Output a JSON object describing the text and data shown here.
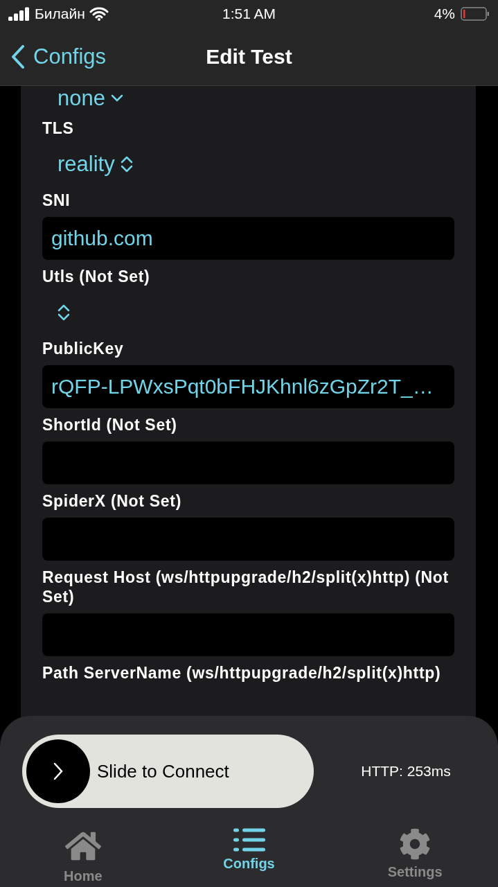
{
  "status_bar": {
    "carrier": "Билайн",
    "time": "1:51 AM",
    "battery": "4%"
  },
  "nav": {
    "back": "Configs",
    "title": "Edit Test"
  },
  "form": [
    {
      "kind": "picker",
      "value": "none"
    },
    {
      "kind": "label",
      "text": "TLS"
    },
    {
      "kind": "picker",
      "value": "reality"
    },
    {
      "kind": "label",
      "text": "SNI"
    },
    {
      "kind": "field",
      "value": "github.com"
    },
    {
      "kind": "label",
      "text": "Utls (Not Set)"
    },
    {
      "kind": "picker"
    },
    {
      "kind": "label",
      "text": "PublicKey"
    },
    {
      "kind": "field",
      "value": "rQFP-LPWxsPqt0bFHJKhnl6zGpZr2T_…"
    },
    {
      "kind": "label",
      "text": "ShortId (Not Set)"
    },
    {
      "kind": "field"
    },
    {
      "kind": "label",
      "text": "SpiderX (Not Set)"
    },
    {
      "kind": "field"
    },
    {
      "kind": "label",
      "text": "Request Host (ws/httpupgrade/h2/split(x)http) (Not Set)"
    },
    {
      "kind": "field"
    },
    {
      "kind": "label",
      "text": "Path ServerName (ws/httpupgrade/h2/split(x)http)"
    }
  ],
  "connect": {
    "slider_label": "Slide to Connect",
    "level": 0,
    "latency": "HTTP: 253ms"
  },
  "tabs": [
    {
      "label": "Home",
      "selected": false
    },
    {
      "label": "Configs",
      "selected": true
    },
    {
      "label": "Settings",
      "selected": false
    }
  ]
}
